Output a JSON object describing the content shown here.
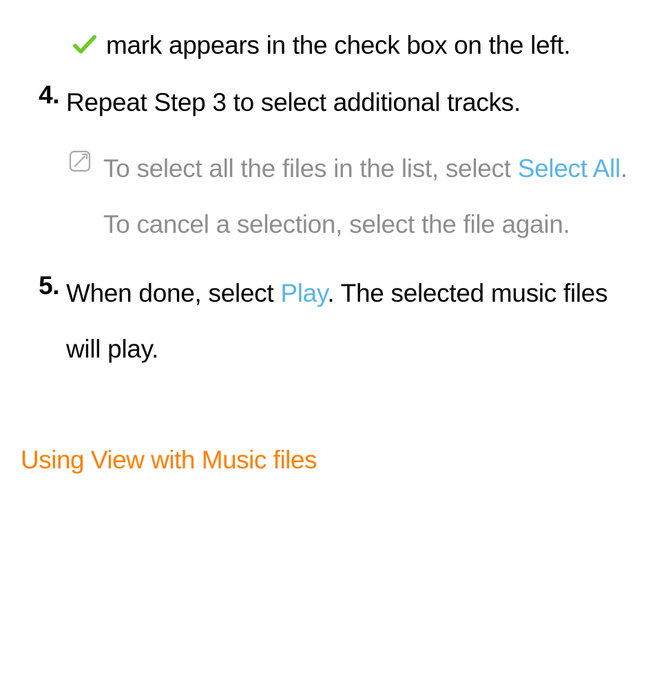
{
  "colors": {
    "highlight_blue": "#58b4e9",
    "heading_orange": "#ff7f00",
    "note_gray": "#8e8e8e",
    "check_green": "#6bcb2b"
  },
  "step3_continuation": {
    "after_check": " mark appears in the check box on the left."
  },
  "step4": {
    "num": "4.",
    "text": "Repeat Step 3 to select additional tracks."
  },
  "note": {
    "pre": "To select all the files in the list, select ",
    "hl": "Select All",
    "post": ". To cancel a selection, select the file again."
  },
  "step5": {
    "num": "5.",
    "pre": "When done, select ",
    "hl": "Play",
    "post": ". The selected music files will play."
  },
  "heading": "Using View with Music files"
}
